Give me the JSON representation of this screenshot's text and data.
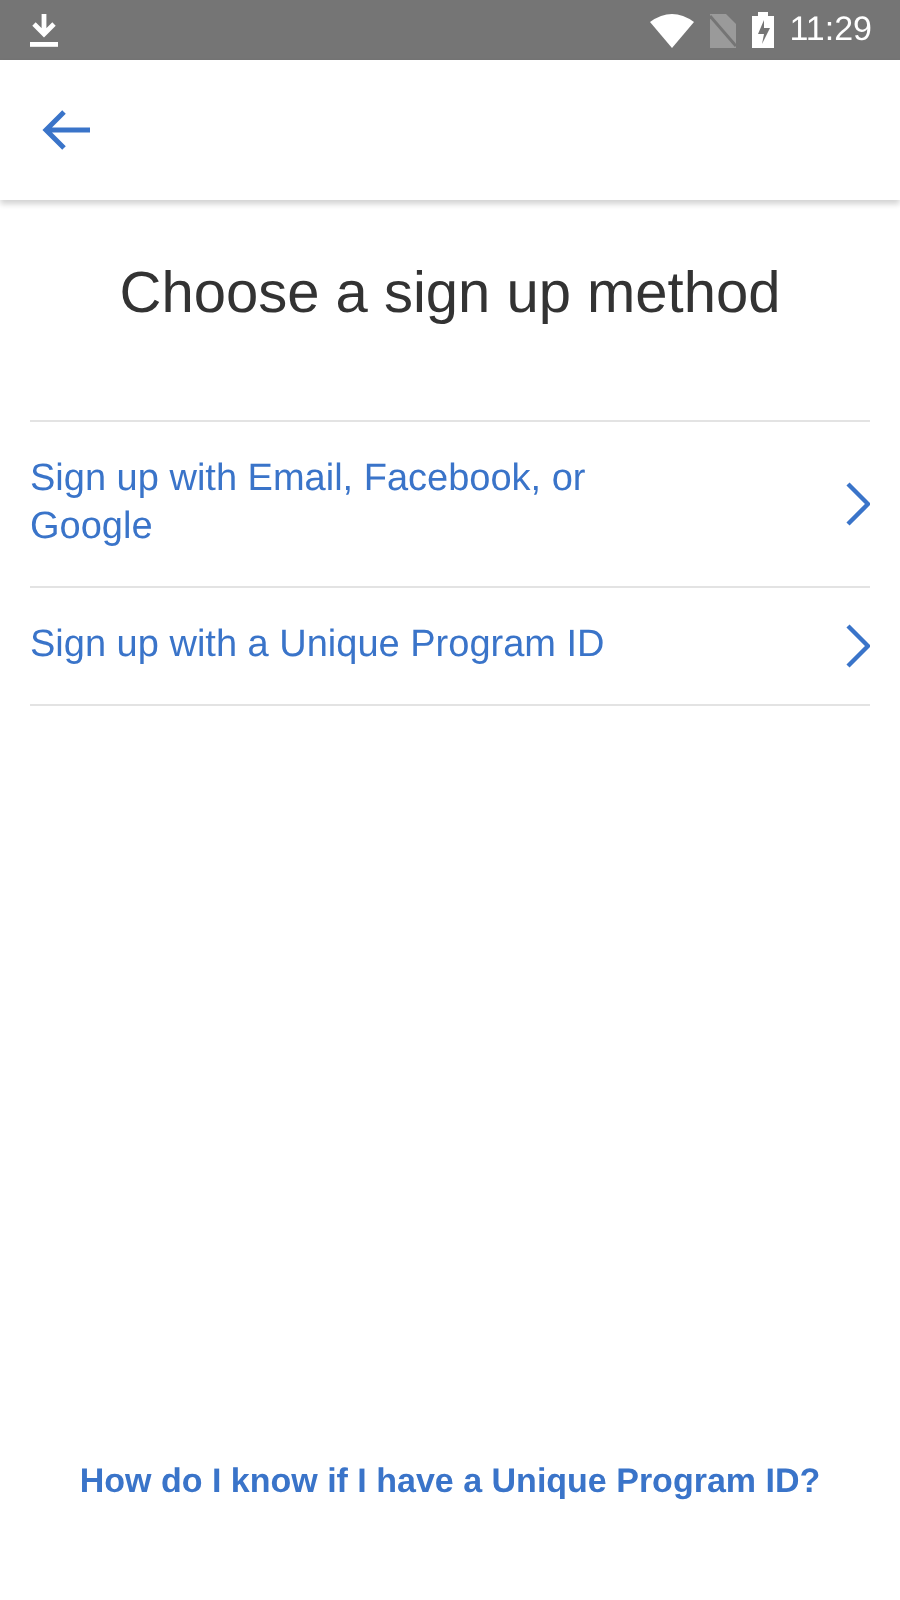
{
  "status_bar": {
    "time": "11:29"
  },
  "title": "Choose a sign up method",
  "options": [
    {
      "label": "Sign up with Email, Facebook, or Google"
    },
    {
      "label": "Sign up with a Unique Program ID"
    }
  ],
  "help_link": "How do I know if I have a Unique Program ID?"
}
